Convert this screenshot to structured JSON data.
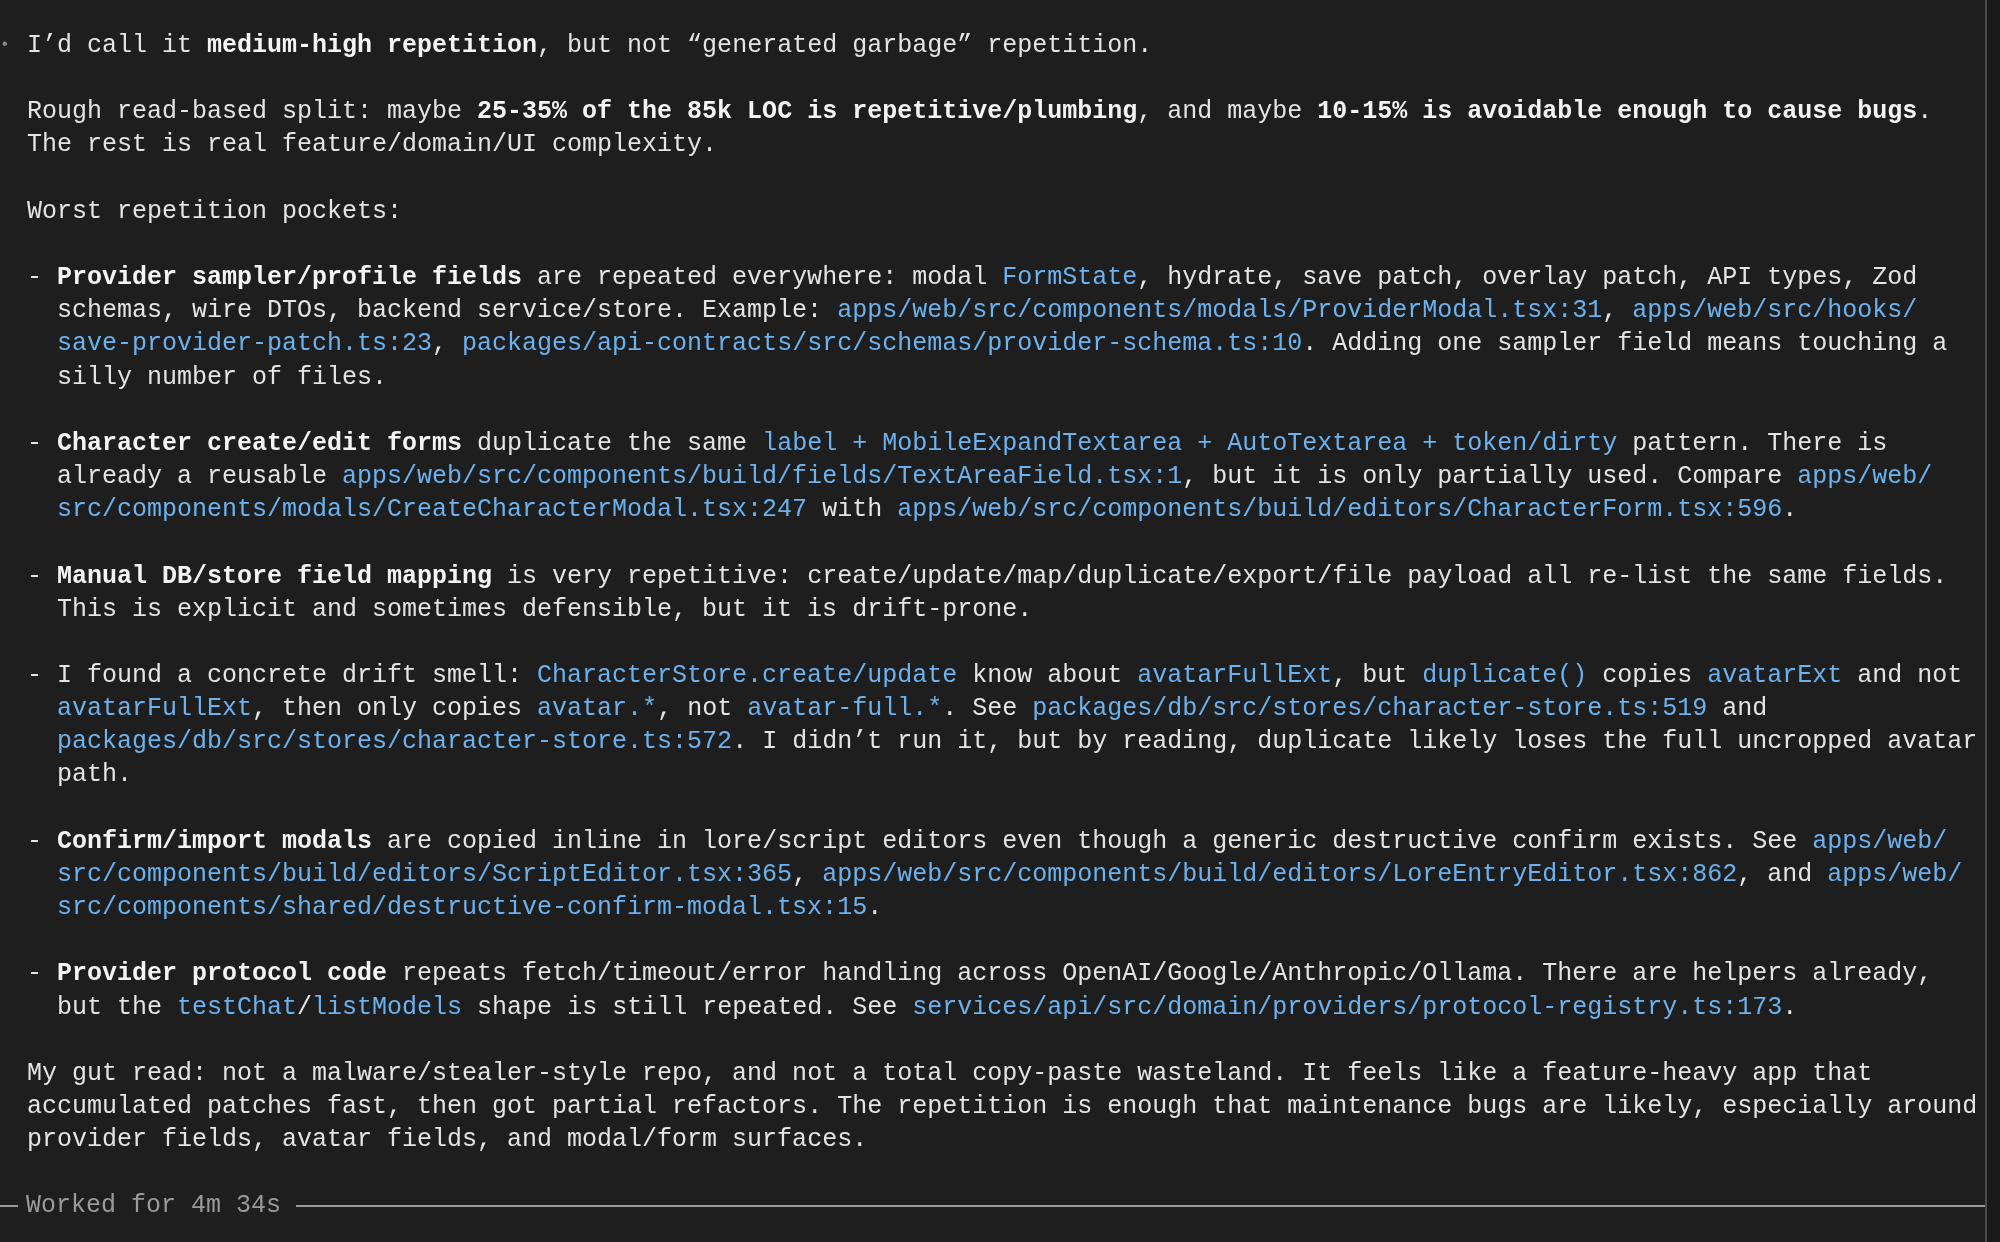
{
  "message": {
    "marker": "•",
    "blocks": [
      {
        "kind": "paragraph",
        "lines": [
          [
            {
              "kind": "text",
              "text": "I’d call it **medium-high repetition**, but not “generated garbage” repetition."
            }
          ]
        ]
      },
      {
        "kind": "paragraph",
        "lines": [
          [
            {
              "kind": "text",
              "text": "Rough read-based split: maybe **25-35% of the 85k LOC is repetitive/plumbing**, and maybe **10-15% is avoidable enough to cause bugs**."
            }
          ],
          [
            {
              "kind": "text",
              "text": "The rest is real feature/domain/UI complexity."
            }
          ]
        ]
      },
      {
        "kind": "paragraph",
        "lines": [
          [
            {
              "kind": "text",
              "text": "Worst repetition pockets:"
            }
          ]
        ]
      },
      {
        "kind": "bullet",
        "marker": "-",
        "lines": [
          [
            {
              "kind": "text",
              "text": "**Provider sampler/profile fields** are repeated everywhere: modal "
            },
            {
              "kind": "code",
              "text": "FormState"
            },
            {
              "kind": "text",
              "text": ", hydrate, save patch, overlay patch, API types, Zod"
            }
          ],
          [
            {
              "kind": "text",
              "text": "schemas, wire DTOs, backend service/store. Example: "
            },
            {
              "kind": "code",
              "text": "apps/web/src/components/modals/ProviderModal.tsx:31"
            },
            {
              "kind": "text",
              "text": ", "
            },
            {
              "kind": "code",
              "text": "apps/web/src/hooks/"
            }
          ],
          [
            {
              "kind": "code",
              "text": "save-provider-patch.ts:23"
            },
            {
              "kind": "text",
              "text": ", "
            },
            {
              "kind": "code",
              "text": "packages/api-contracts/src/schemas/provider-schema.ts:10"
            },
            {
              "kind": "text",
              "text": ". Adding one sampler field means touching a"
            }
          ],
          [
            {
              "kind": "text",
              "text": "silly number of files."
            }
          ]
        ]
      },
      {
        "kind": "bullet",
        "marker": "-",
        "lines": [
          [
            {
              "kind": "text",
              "text": "**Character create/edit forms** duplicate the same "
            },
            {
              "kind": "code",
              "text": "label + MobileExpandTextarea + AutoTextarea + token/dirty"
            },
            {
              "kind": "text",
              "text": " pattern. There is"
            }
          ],
          [
            {
              "kind": "text",
              "text": "already a reusable "
            },
            {
              "kind": "code",
              "text": "apps/web/src/components/build/fields/TextAreaField.tsx:1"
            },
            {
              "kind": "text",
              "text": ", but it is only partially used. Compare "
            },
            {
              "kind": "code",
              "text": "apps/web/"
            }
          ],
          [
            {
              "kind": "code",
              "text": "src/components/modals/CreateCharacterModal.tsx:247"
            },
            {
              "kind": "text",
              "text": " with "
            },
            {
              "kind": "code",
              "text": "apps/web/src/components/build/editors/CharacterForm.tsx:596"
            },
            {
              "kind": "text",
              "text": "."
            }
          ]
        ]
      },
      {
        "kind": "bullet",
        "marker": "-",
        "lines": [
          [
            {
              "kind": "text",
              "text": "**Manual DB/store field mapping** is very repetitive: create/update/map/duplicate/export/file payload all re-list the same fields."
            }
          ],
          [
            {
              "kind": "text",
              "text": "This is explicit and sometimes defensible, but it is drift-prone."
            }
          ]
        ]
      },
      {
        "kind": "bullet",
        "marker": "-",
        "lines": [
          [
            {
              "kind": "text",
              "text": "I found a concrete drift smell: "
            },
            {
              "kind": "code",
              "text": "CharacterStore.create/update"
            },
            {
              "kind": "text",
              "text": " know about "
            },
            {
              "kind": "code",
              "text": "avatarFullExt"
            },
            {
              "kind": "text",
              "text": ", but "
            },
            {
              "kind": "code",
              "text": "duplicate()"
            },
            {
              "kind": "text",
              "text": " copies "
            },
            {
              "kind": "code",
              "text": "avatarExt"
            },
            {
              "kind": "text",
              "text": " and not"
            }
          ],
          [
            {
              "kind": "code",
              "text": "avatarFullExt"
            },
            {
              "kind": "text",
              "text": ", then only copies "
            },
            {
              "kind": "code",
              "text": "avatar.*"
            },
            {
              "kind": "text",
              "text": ", not "
            },
            {
              "kind": "code",
              "text": "avatar-full.*"
            },
            {
              "kind": "text",
              "text": ". See "
            },
            {
              "kind": "code",
              "text": "packages/db/src/stores/character-store.ts:519"
            },
            {
              "kind": "text",
              "text": " and"
            }
          ],
          [
            {
              "kind": "code",
              "text": "packages/db/src/stores/character-store.ts:572"
            },
            {
              "kind": "text",
              "text": ". I didn’t run it, but by reading, duplicate likely loses the full uncropped avatar"
            }
          ],
          [
            {
              "kind": "text",
              "text": "path."
            }
          ]
        ]
      },
      {
        "kind": "bullet",
        "marker": "-",
        "lines": [
          [
            {
              "kind": "text",
              "text": "**Confirm/import modals** are copied inline in lore/script editors even though a generic destructive confirm exists. See "
            },
            {
              "kind": "code",
              "text": "apps/web/"
            }
          ],
          [
            {
              "kind": "code",
              "text": "src/components/build/editors/ScriptEditor.tsx:365"
            },
            {
              "kind": "text",
              "text": ", "
            },
            {
              "kind": "code",
              "text": "apps/web/src/components/build/editors/LoreEntryEditor.tsx:862"
            },
            {
              "kind": "text",
              "text": ", and "
            },
            {
              "kind": "code",
              "text": "apps/web/"
            }
          ],
          [
            {
              "kind": "code",
              "text": "src/components/shared/destructive-confirm-modal.tsx:15"
            },
            {
              "kind": "text",
              "text": "."
            }
          ]
        ]
      },
      {
        "kind": "bullet",
        "marker": "-",
        "lines": [
          [
            {
              "kind": "text",
              "text": "**Provider protocol code** repeats fetch/timeout/error handling across OpenAI/Google/Anthropic/Ollama. There are helpers already,"
            }
          ],
          [
            {
              "kind": "text",
              "text": "but the "
            },
            {
              "kind": "code",
              "text": "testChat"
            },
            {
              "kind": "text",
              "text": "/"
            },
            {
              "kind": "code",
              "text": "listModels"
            },
            {
              "kind": "text",
              "text": " shape is still repeated. See "
            },
            {
              "kind": "code",
              "text": "services/api/src/domain/providers/protocol-registry.ts:173"
            },
            {
              "kind": "text",
              "text": "."
            }
          ]
        ]
      },
      {
        "kind": "paragraph",
        "lines": [
          [
            {
              "kind": "text",
              "text": "My gut read: not a malware/stealer-style repo, and not a total copy-paste wasteland. It feels like a feature-heavy app that"
            }
          ],
          [
            {
              "kind": "text",
              "text": "accumulated patches fast, then got partial refactors. The repetition is enough that maintenance bugs are likely, especially around"
            }
          ],
          [
            {
              "kind": "text",
              "text": "provider fields, avatar fields, and modal/form surfaces."
            }
          ]
        ]
      }
    ]
  },
  "footer": {
    "text": "Worked for 4m 34s"
  }
}
